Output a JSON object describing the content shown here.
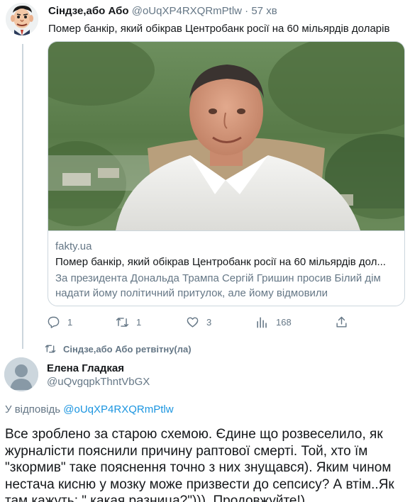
{
  "tweet": {
    "author_name": "Сіндзе,або Або",
    "author_handle": "@oUqXP4RXQRmPtlw",
    "separator": "·",
    "time": "57 хв",
    "text": "Помер банкір, який обікрав Центробанк росії на 60 мільярдів доларів",
    "card": {
      "domain": "fakty.ua",
      "title": "Помер банкір, який обікрав Центробанк росії на 60 мільярдів дол...",
      "description": "За президента Дональда Трампа Сергій Гришин просив Білий дім надати йому політичний притулок, але йому відмовили"
    },
    "actions": {
      "reply_count": "1",
      "retweet_count": "1",
      "like_count": "3",
      "analytics_count": "168"
    },
    "icons": {
      "reply": "reply-icon",
      "retweet": "retweet-icon",
      "like": "heart-icon",
      "analytics": "analytics-icon",
      "share": "share-icon"
    }
  },
  "retweet_note": "Сіндзе,або Або ретвітну(ла)",
  "reply": {
    "author_name": "Елена Гладкая",
    "author_handle": "@uQvgqpkThntVbGX",
    "replying_prefix": "У відповідь",
    "replying_to": "@oUqXP4RXQRmPtlw",
    "text": "Все зроблено за старою схемою. Єдине що розвеселило, як журналісти пояснили причину раптової смерті. Той, хто їм \"зкормив\" таке пояснення точно з них знущався). Яким чином нестача кисню у мозку може призвести до сепсису?  А втім..Як там кажуть: \" какая разница?\"))). Продовжуйте!)"
  },
  "colors": {
    "link": "#1b95e0",
    "secondary_text": "#657786",
    "border": "#ccd6dd",
    "primary_text": "#14171a"
  }
}
